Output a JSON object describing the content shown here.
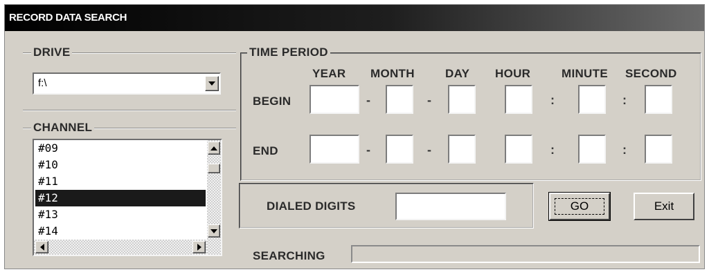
{
  "window": {
    "title": "RECORD DATA SEARCH"
  },
  "drive": {
    "group_label": "DRIVE",
    "selected": "f:\\",
    "dropdown_icon": "chevron-down-icon"
  },
  "channel": {
    "group_label": "CHANNEL",
    "items": [
      "#09",
      "#10",
      "#11",
      "#12",
      "#13",
      "#14"
    ],
    "selected_index": 3
  },
  "time_period": {
    "group_label": "TIME PERIOD",
    "columns": [
      "YEAR",
      "MONTH",
      "DAY",
      "HOUR",
      "MINUTE",
      "SECOND"
    ],
    "rows": [
      {
        "label": "BEGIN",
        "values": [
          "",
          "",
          "",
          "",
          "",
          ""
        ]
      },
      {
        "label": "END",
        "values": [
          "",
          "",
          "",
          "",
          "",
          ""
        ]
      }
    ],
    "date_separator": "-",
    "time_separator": ":"
  },
  "dialed_digits": {
    "label": "DIALED DIGITS",
    "value": ""
  },
  "buttons": {
    "go": "GO",
    "exit": "Exit"
  },
  "status": {
    "label": "SEARCHING",
    "progress": 0
  },
  "colors": {
    "selection": "#1a1a1a",
    "face": "#d4d0c8"
  }
}
